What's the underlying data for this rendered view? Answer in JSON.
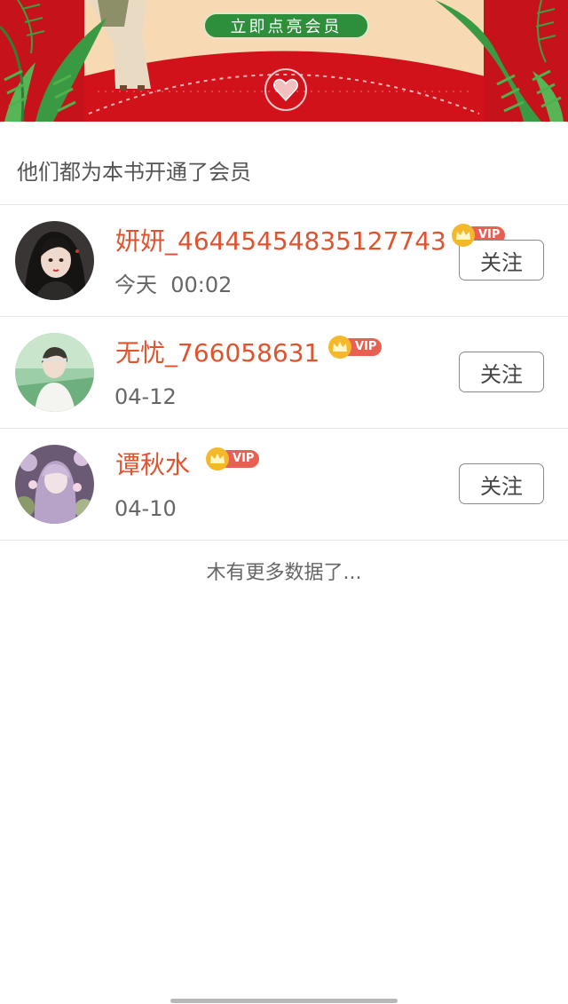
{
  "banner": {
    "cta_label": "立即点亮会员",
    "colors": {
      "red": "#d6141c",
      "green": "#2d8f3c",
      "cream": "#f7d9b4"
    }
  },
  "section_title": "他们都为本书开通了会员",
  "members": [
    {
      "name": "妍妍_46445454835127743",
      "time": "今天  00:02",
      "vip_label": "VIP",
      "follow_label": "关注"
    },
    {
      "name": "无忧_766058631",
      "time": "04-12",
      "vip_label": "VIP",
      "follow_label": "关注"
    },
    {
      "name": "谭秋水",
      "time": "04-10",
      "vip_label": "VIP",
      "follow_label": "关注"
    }
  ],
  "footer_text": "木有更多数据了...",
  "icons": [
    "heart-seal-icon",
    "crown-icon",
    "home-indicator"
  ]
}
